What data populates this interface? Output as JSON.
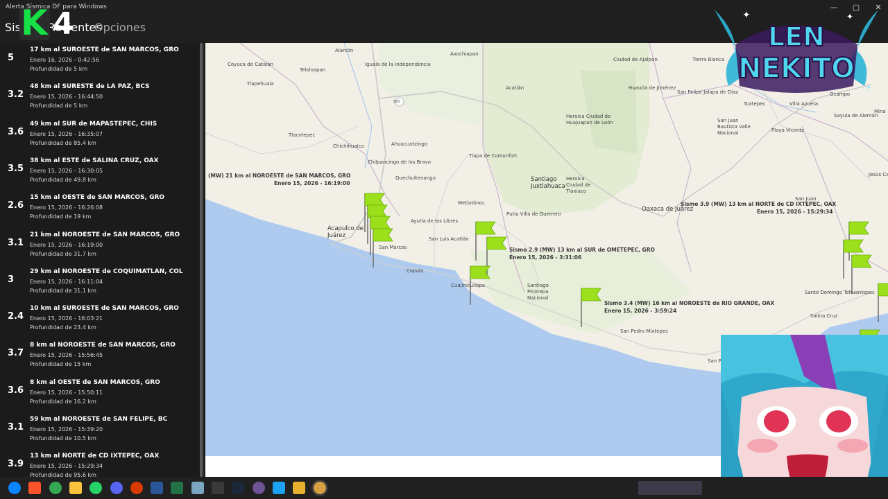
{
  "window": {
    "title": "Alerta Sísmica DF para Windows",
    "controls": {
      "minimize": "—",
      "maximize": "▢",
      "close": "✕"
    }
  },
  "nav": {
    "tab_recent": "Sismos Recientes",
    "tab_options": "Opciones"
  },
  "overlay": {
    "k4_letter": "K",
    "k4_number": "4",
    "nekito_line1": "LEN",
    "nekito_line2": "NEKITO"
  },
  "quakes": [
    {
      "mag": "5",
      "location": "17 km al SUROESTE de SAN MARCOS, GRO",
      "date": "Enero 16, 2026 - 0:42:56",
      "depth": "Profundidad de 5 km"
    },
    {
      "mag": "3.2",
      "location": "48 km al SURESTE de LA PAZ, BCS",
      "date": "Enero 15, 2026 - 16:44:50",
      "depth": "Profundidad de 5 km"
    },
    {
      "mag": "3.6",
      "location": "49 km al SUR de MAPASTEPEC, CHIS",
      "date": "Enero 15, 2026 - 16:35:07",
      "depth": "Profundidad de 85.4 km"
    },
    {
      "mag": "3.5",
      "location": "38 km al ESTE de SALINA CRUZ, OAX",
      "date": "Enero 15, 2026 - 16:30:05",
      "depth": "Profundidad de 49.8 km"
    },
    {
      "mag": "2.6",
      "location": "15 km al OESTE de SAN MARCOS, GRO",
      "date": "Enero 15, 2026 - 16:26:08",
      "depth": "Profundidad de 19 km"
    },
    {
      "mag": "3.1",
      "location": "21 km al NOROESTE de SAN MARCOS, GRO",
      "date": "Enero 15, 2026 - 16:19:00",
      "depth": "Profundidad de 31.7 km"
    },
    {
      "mag": "3",
      "location": "29 km al NOROESTE de COQUIMATLAN, COL",
      "date": "Enero 15, 2026 - 16:11:04",
      "depth": "Profundidad de 31.1 km"
    },
    {
      "mag": "2.4",
      "location": "10 km al SUROESTE de SAN MARCOS, GRO",
      "date": "Enero 15, 2026 - 16:03:21",
      "depth": "Profundidad de 23.4 km"
    },
    {
      "mag": "3.7",
      "location": "8 km al NOROESTE de SAN MARCOS, GRO",
      "date": "Enero 15, 2026 - 15:56:45",
      "depth": "Profundidad de 15 km"
    },
    {
      "mag": "3.6",
      "location": "8 km al OESTE de SAN MARCOS, GRO",
      "date": "Enero 15, 2026 - 15:50:11",
      "depth": "Profundidad de 16.2 km"
    },
    {
      "mag": "3.1",
      "location": "59 km al NOROESTE de SAN FELIPE, BC",
      "date": "Enero 15, 2026 - 15:39:20",
      "depth": "Profundidad de 10.5 km"
    },
    {
      "mag": "3.9",
      "location": "13 km al NORTE de CD IXTEPEC, OAX",
      "date": "Enero 15, 2026 - 15:29:34",
      "depth": "Profundidad de 95.6 km"
    }
  ],
  "map": {
    "places": [
      "Alarcón",
      "Coyuca de Catalán",
      "Teloloapan",
      "Iguala de la Independencia",
      "Axochiapan",
      "Ciudad de Ajalpan",
      "Tierra Blanca",
      "Tlapehuala",
      "Acatlán",
      "Huautla de Jiménez",
      "San Felipe Jalapa de Díaz",
      "Tuxtepec",
      "Villa Azueta",
      "Ocampo",
      "Heroica Ciudad de Huajuapan de León",
      "Tlacotepec",
      "Chichihualco",
      "Ahuacuotzingo",
      "San Juan Bautista Valle Nacional",
      "Playa Vicente",
      "Sayula de Alemán",
      "Tlapa de Comonfort",
      "Chilpancingo de los Bravo",
      "Quechultenango",
      "Santiago Juxtlahuaca",
      "Heroica Ciudad de Tlaxiaco",
      "Jesús Carranza",
      "Metlatónoc",
      "Putla Villa de Guerrero",
      "Oaxaca de Juárez",
      "San Juan",
      "Ayutla de los Libres",
      "Acapulco de Juárez",
      "San Luis Acatlán",
      "San Marcos",
      "Copala",
      "Cuajinicuilapa",
      "Santiago Pinotepa Nacional",
      "Santo Domingo Tehuantepec",
      "Salina Cruz",
      "San Pedro Mixtepec",
      "San Pedro Pochutla",
      "Mina"
    ],
    "road_badge": "950",
    "labels": [
      {
        "title": "(MW) 21 km al NOROESTE de SAN MARCOS, GRO",
        "date": "Enero 15, 2026 - 16:19:00"
      },
      {
        "title": "Sismo 2.9 (MW) 13 km al SUR de OMETEPEC, GRO",
        "date": "Enero 15, 2026 - 3:31:06"
      },
      {
        "title": "Sismo 3.4 (MW) 16 km al NOROESTE de RIO GRANDE, OAX",
        "date": "Enero 15, 2026 - 3:59:24"
      },
      {
        "title": "Sismo 3.9 (MW) 13 km al NORTE de CD IXTEPEC, OAX",
        "date": "Enero 15, 2026 - 15:29:34"
      }
    ]
  },
  "colors": {
    "flag_green": "#9be01a",
    "ocean": "#aecbef",
    "land": "#f1efe6",
    "sidebar_bg": "#1b1b1b",
    "k4_green": "#16e046"
  },
  "taskbar": {
    "icons": [
      "windows-start-icon",
      "brave-icon",
      "chrome-icon",
      "file-explorer-icon",
      "whatsapp-icon",
      "discord-icon",
      "pdf-icon",
      "word-icon",
      "excel-icon",
      "v-app-icon",
      "terminal-icon",
      "steam-icon",
      "github-icon",
      "twitter-icon",
      "store-icon",
      "alert-app-icon"
    ]
  }
}
